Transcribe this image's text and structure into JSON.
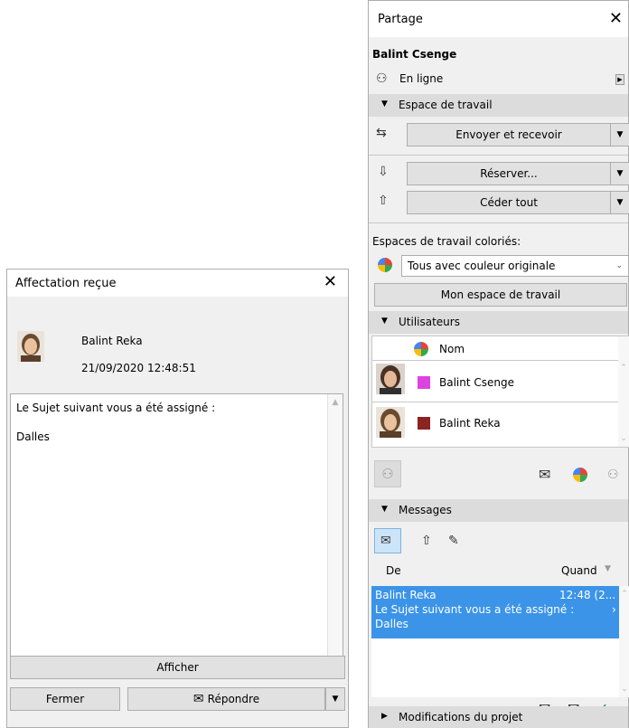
{
  "assignment_dialog": {
    "title": "Affectation reçue",
    "sender": "Balint Reka",
    "datetime": "21/09/2020 12:48:51",
    "message_line1": "Le Sujet suivant vous a été assigné :",
    "message_line2": "Dalles",
    "show_label": "Afficher",
    "close_label": "Fermer",
    "reply_label": "Répondre"
  },
  "sharing_panel": {
    "title": "Partage",
    "user_name": "Balint Csenge",
    "status": "En ligne",
    "workspace_section": "Espace de travail",
    "send_receive_label": "Envoyer et recevoir",
    "reserve_label": "Réserver...",
    "release_all_label": "Céder tout",
    "colored_workspaces_label": "Espaces de travail coloriés:",
    "color_mode": "Tous avec couleur originale",
    "my_workspace_label": "Mon espace de travail",
    "users_section": "Utilisateurs",
    "users_col_name": "Nom",
    "users": [
      {
        "name": "Balint Csenge",
        "color": "#dd44dd"
      },
      {
        "name": "Balint Reka",
        "color": "#8b2323"
      }
    ],
    "messages_section": "Messages",
    "messages_col_from": "De",
    "messages_col_when": "Quand",
    "messages": [
      {
        "from": "Balint Reka",
        "when": "12:48 (2...",
        "body": "Le Sujet suivant vous a été assigné :",
        "body2": "Dalles"
      }
    ],
    "changes_section": "Modifications du projet"
  },
  "colors": {
    "selection": "#3b94e8",
    "section_header": "#dcdcdc",
    "panel_bg": "#f0f0f0"
  }
}
